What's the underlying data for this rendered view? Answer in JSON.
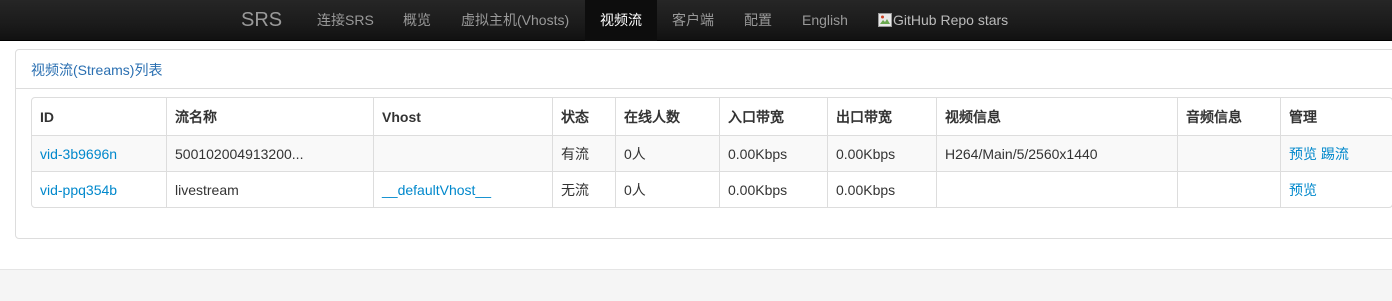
{
  "navbar": {
    "brand": "SRS",
    "items": [
      {
        "label": "连接SRS"
      },
      {
        "label": "概览"
      },
      {
        "label": "虚拟主机(Vhosts)"
      },
      {
        "label": "视频流",
        "active": true
      },
      {
        "label": "客户端"
      },
      {
        "label": "配置"
      },
      {
        "label": "English"
      }
    ],
    "github_badge_alt": "GitHub Repo stars"
  },
  "panel": {
    "title": "视频流(Streams)列表"
  },
  "table": {
    "headers": [
      "ID",
      "流名称",
      "Vhost",
      "状态",
      "在线人数",
      "入口带宽",
      "出口带宽",
      "视频信息",
      "音频信息",
      "管理"
    ],
    "rows": [
      {
        "id": "vid-3b9696n",
        "name": "500102004913200...",
        "vhost": "",
        "status": "有流",
        "clients": "0人",
        "recv": "0.00Kbps",
        "send": "0.00Kbps",
        "video": "H264/Main/5/2560x1440",
        "audio": "",
        "actions": {
          "preview": "预览",
          "kick": "踢流"
        }
      },
      {
        "id": "vid-ppq354b",
        "name": "livestream",
        "vhost": "__defaultVhost__",
        "status": "无流",
        "clients": "0人",
        "recv": "0.00Kbps",
        "send": "0.00Kbps",
        "video": "",
        "audio": "",
        "actions": {
          "preview": "预览"
        }
      }
    ]
  },
  "colors": {
    "navbar_bg": "#1b1b1b",
    "nav_text": "#999999",
    "nav_active_text": "#ffffff",
    "link": "#0088cc",
    "panel_title": "#2a6fb1"
  }
}
